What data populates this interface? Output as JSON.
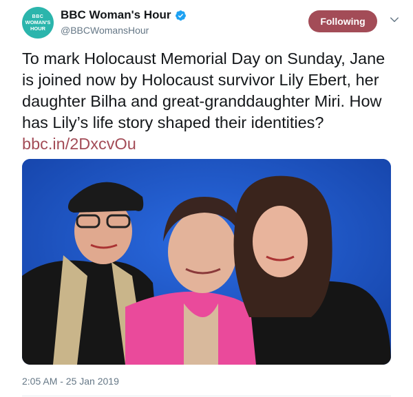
{
  "account": {
    "display_name": "BBC Woman's Hour",
    "handle": "@BBCWomansHour",
    "avatar_lines": [
      "BBC",
      "WOMAN'S",
      "HOUR"
    ],
    "avatar_color": "#2bb5ac",
    "verified": true
  },
  "follow_button": {
    "label": "Following",
    "color": "#a34c57"
  },
  "menu_icon": "chevron-down-icon",
  "tweet": {
    "text": "To mark Holocaust Memorial Day on Sunday, Jane is joined now by Holocaust survivor Lily Ebert, her daughter Bilha and great-granddaughter Miri. How has Lily’s life story shaped their identities?",
    "link_text": "bbc.in/2DxcvOu",
    "link_color": "#a34c57"
  },
  "media": {
    "icon": "photo-icon",
    "background_color": "#1f57c4"
  },
  "timestamp": "2:05 AM - 25 Jan 2019"
}
